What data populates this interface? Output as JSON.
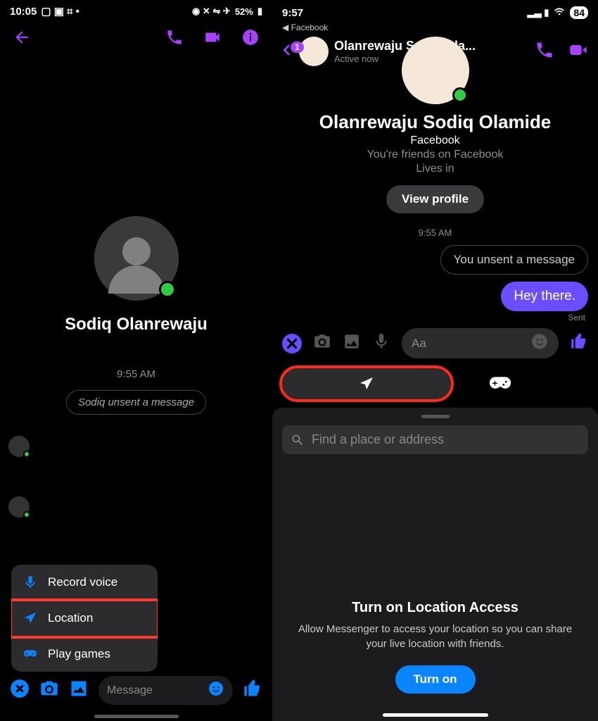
{
  "left": {
    "status_time": "10:05",
    "battery_pct": "52%",
    "name": "Sodiq Olanrewaju",
    "timestamp": "9:55 AM",
    "unsent_text": "Sodiq unsent a message",
    "menu": {
      "voice": "Record voice",
      "location": "Location",
      "games": "Play games"
    },
    "input_placeholder": "Message"
  },
  "right": {
    "status_time": "9:57",
    "battery_pct": "84",
    "breadcrumb": "◀ Facebook",
    "badge": "1",
    "header_name": "Olanrewaju Sodiq Ola...",
    "header_status": "Active now",
    "profile_name": "Olanrewaju Sodiq Olamide",
    "profile_platform": "Facebook",
    "profile_friends": "You're friends on Facebook",
    "profile_lives": "Lives in",
    "view_profile": "View profile",
    "timestamp": "9:55 AM",
    "system_msg": "You unsent a message",
    "chat_msg": "Hey there.",
    "sent_label": "Sent",
    "input_placeholder": "Aa",
    "search_placeholder": "Find a place or address",
    "loc_title": "Turn on Location Access",
    "loc_desc": "Allow Messenger to access your location so you can share your live location with friends.",
    "turn_on": "Turn on"
  }
}
